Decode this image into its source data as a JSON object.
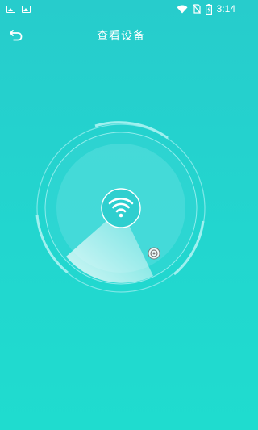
{
  "status_bar": {
    "time": "3:14",
    "icons": [
      "image-icon",
      "image-icon",
      "wifi-icon",
      "no-sim-icon",
      "battery-charging-icon"
    ]
  },
  "header": {
    "title": "查看设备",
    "back_icon": "back-arrow-icon"
  },
  "radar": {
    "center_icon": "wifi-icon",
    "device_marker_icon": "device-marker-icon"
  },
  "colors": {
    "background": "#27cccc",
    "ring": "#7de7e7",
    "sweep": "#ffffff"
  }
}
